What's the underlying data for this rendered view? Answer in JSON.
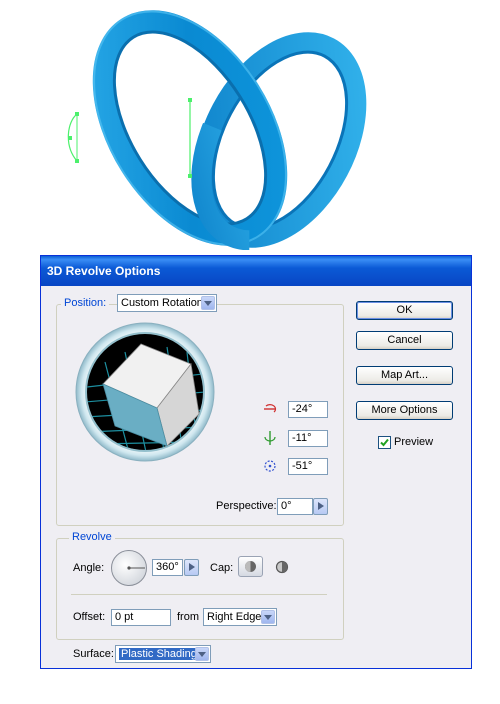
{
  "dialog": {
    "title": "3D Revolve Options",
    "position_label": "Position:",
    "position_value": "Custom Rotation",
    "rotation_x": "-24°",
    "rotation_y": "-11°",
    "rotation_z": "-51°",
    "perspective_label": "Perspective:",
    "perspective_value": "0°",
    "revolve_legend": "Revolve",
    "angle_label": "Angle:",
    "angle_value": "360°",
    "cap_label": "Cap:",
    "offset_label": "Offset:",
    "offset_value": "0 pt",
    "from_label": "from",
    "from_value": "Right Edge",
    "surface_label": "Surface:",
    "surface_value": "Plastic Shading",
    "buttons": {
      "ok": "OK",
      "cancel": "Cancel",
      "map_art": "Map Art...",
      "more_options": "More Options"
    },
    "preview_label": "Preview",
    "preview_checked": true
  },
  "colors": {
    "ring_blue": "#0f8fd6",
    "path_green": "#4cf06c",
    "title_blue": "#0a5fd4",
    "cube_face": "#6aaec4"
  }
}
